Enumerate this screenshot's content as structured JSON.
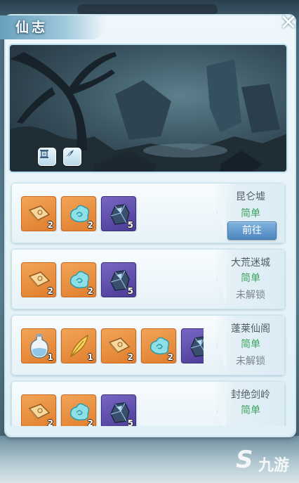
{
  "window": {
    "title": "仙志",
    "close_icon": "close-icon"
  },
  "scene": {
    "buttons": [
      {
        "icon": "scroll-icon"
      },
      {
        "icon": "feather-icon"
      }
    ]
  },
  "stages": [
    {
      "name": "昆仑墟",
      "difficulty": "简单",
      "status": "",
      "action": "前往",
      "rewards": [
        {
          "icon": "book-icon",
          "count": "2"
        },
        {
          "icon": "cloud-icon",
          "count": "2"
        },
        {
          "icon": "crystal-ore-icon",
          "count": "5"
        }
      ]
    },
    {
      "name": "大荒迷城",
      "difficulty": "简单",
      "status": "未解锁",
      "action": "",
      "rewards": [
        {
          "icon": "book-icon",
          "count": "2"
        },
        {
          "icon": "cloud-icon",
          "count": "2"
        },
        {
          "icon": "crystal-ore-icon",
          "count": "5"
        }
      ]
    },
    {
      "name": "蓬莱仙阁",
      "difficulty": "简单",
      "status": "未解锁",
      "action": "",
      "rewards": [
        {
          "icon": "potion-bottle-icon",
          "count": "1"
        },
        {
          "icon": "golden-feather-icon",
          "count": "1"
        },
        {
          "icon": "book-icon",
          "count": "2"
        },
        {
          "icon": "cloud-icon",
          "count": "2"
        },
        {
          "icon": "crystal-ore-icon",
          "count": ""
        }
      ]
    },
    {
      "name": "封绝剑岭",
      "difficulty": "简单",
      "status": "",
      "action": "",
      "rewards": [
        {
          "icon": "book-icon",
          "count": "2"
        },
        {
          "icon": "cloud-icon",
          "count": "2"
        },
        {
          "icon": "crystal-ore-icon",
          "count": "5"
        }
      ]
    }
  ],
  "watermark": {
    "logo": "九游"
  }
}
